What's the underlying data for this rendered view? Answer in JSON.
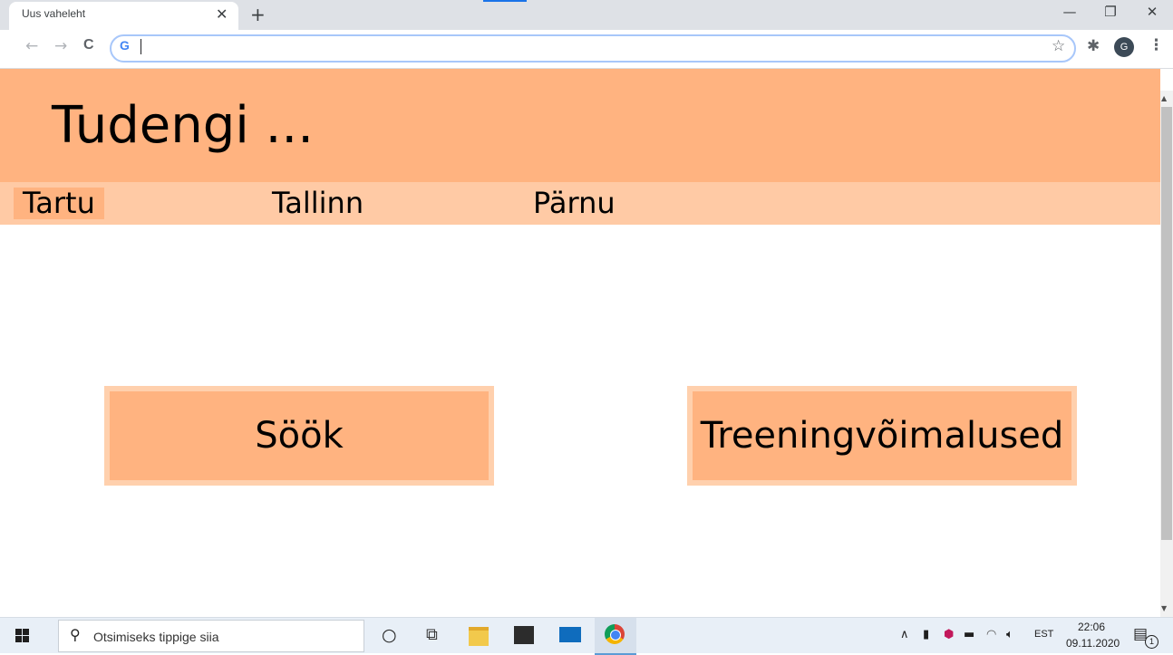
{
  "browser": {
    "tab": {
      "title": "Uus vaheleht",
      "close_glyph": "✕"
    },
    "new_tab_glyph": "+",
    "window_controls": {
      "minimize": "—",
      "restore": "❐",
      "close": "✕"
    },
    "nav": {
      "back": "←",
      "forward": "→",
      "reload": "C"
    },
    "omnibox": {
      "value": "",
      "google_badge": "G"
    },
    "icons": {
      "bookmark": "star-icon",
      "extensions": "puzzle-icon",
      "menu": "kebab-menu-icon"
    },
    "profile_initial": "G"
  },
  "page": {
    "title": "Tudengi ...",
    "nav": [
      {
        "label": "Tartu",
        "active": true
      },
      {
        "label": "Tallinn",
        "active": false
      },
      {
        "label": "Pärnu",
        "active": false
      }
    ],
    "cards": [
      {
        "label": "Söök"
      },
      {
        "label": "Treeningvõimalused"
      }
    ],
    "colors": {
      "header": "#ffb380",
      "nav": "#ffcaa5",
      "active_tab": "#ffb380"
    }
  },
  "taskbar": {
    "search_placeholder": "Otsimiseks tippige siia",
    "tray": {
      "language": "EST",
      "time": "22:06",
      "date": "09.11.2020",
      "notification_count": "1"
    }
  }
}
